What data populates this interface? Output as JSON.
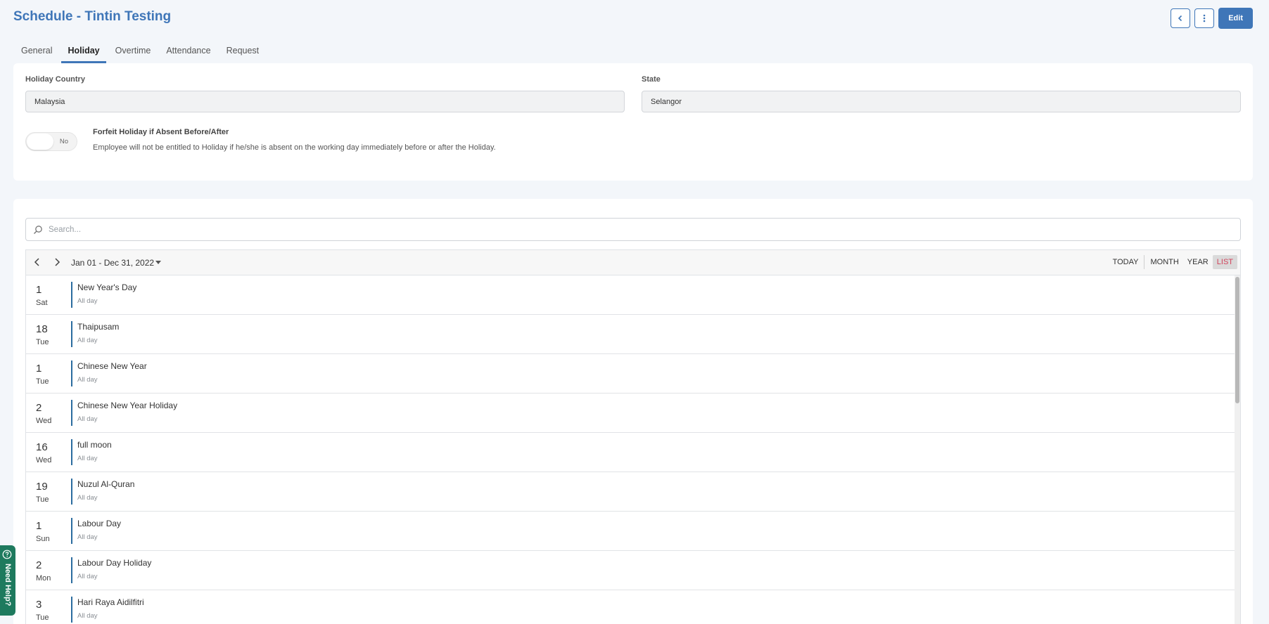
{
  "header": {
    "title": "Schedule - Tintin Testing",
    "back_icon": "chevron-left-icon",
    "more_icon": "kebab-icon",
    "edit_label": "Edit"
  },
  "tabs": [
    {
      "label": "General",
      "active": false
    },
    {
      "label": "Holiday",
      "active": true
    },
    {
      "label": "Overtime",
      "active": false
    },
    {
      "label": "Attendance",
      "active": false
    },
    {
      "label": "Request",
      "active": false
    }
  ],
  "holiday_settings": {
    "country_label": "Holiday Country",
    "country_value": "Malaysia",
    "state_label": "State",
    "state_value": "Selangor",
    "forfeit_toggle": "No",
    "forfeit_title": "Forfeit Holiday if Absent Before/After",
    "forfeit_desc": "Employee will not be entitled to Holiday if he/she is absent on the working day immediately before or after the Holiday."
  },
  "search": {
    "placeholder": "Search..."
  },
  "calendar": {
    "range": "Jan 01 - Dec 31, 2022",
    "views": [
      "TODAY",
      "MONTH",
      "YEAR",
      "LIST"
    ],
    "active_view": "LIST",
    "events": [
      {
        "day": "1",
        "weekday": "Sat",
        "title": "New Year's Day",
        "sub": "All day"
      },
      {
        "day": "18",
        "weekday": "Tue",
        "title": "Thaipusam",
        "sub": "All day"
      },
      {
        "day": "1",
        "weekday": "Tue",
        "title": "Chinese New Year",
        "sub": "All day"
      },
      {
        "day": "2",
        "weekday": "Wed",
        "title": "Chinese New Year Holiday",
        "sub": "All day"
      },
      {
        "day": "16",
        "weekday": "Wed",
        "title": "full moon",
        "sub": "All day"
      },
      {
        "day": "19",
        "weekday": "Tue",
        "title": "Nuzul Al-Quran",
        "sub": "All day"
      },
      {
        "day": "1",
        "weekday": "Sun",
        "title": "Labour Day",
        "sub": "All day"
      },
      {
        "day": "2",
        "weekday": "Mon",
        "title": "Labour Day Holiday",
        "sub": "All day"
      },
      {
        "day": "3",
        "weekday": "Tue",
        "title": "Hari Raya Aidilfitri",
        "sub": "All day"
      }
    ]
  },
  "help": {
    "label": "Need Help?"
  },
  "colors": {
    "accent": "#3f76b8",
    "event_bar": "#2b6c9f",
    "help_bg": "#1e7a5e",
    "active_view_text": "#d1425a"
  }
}
